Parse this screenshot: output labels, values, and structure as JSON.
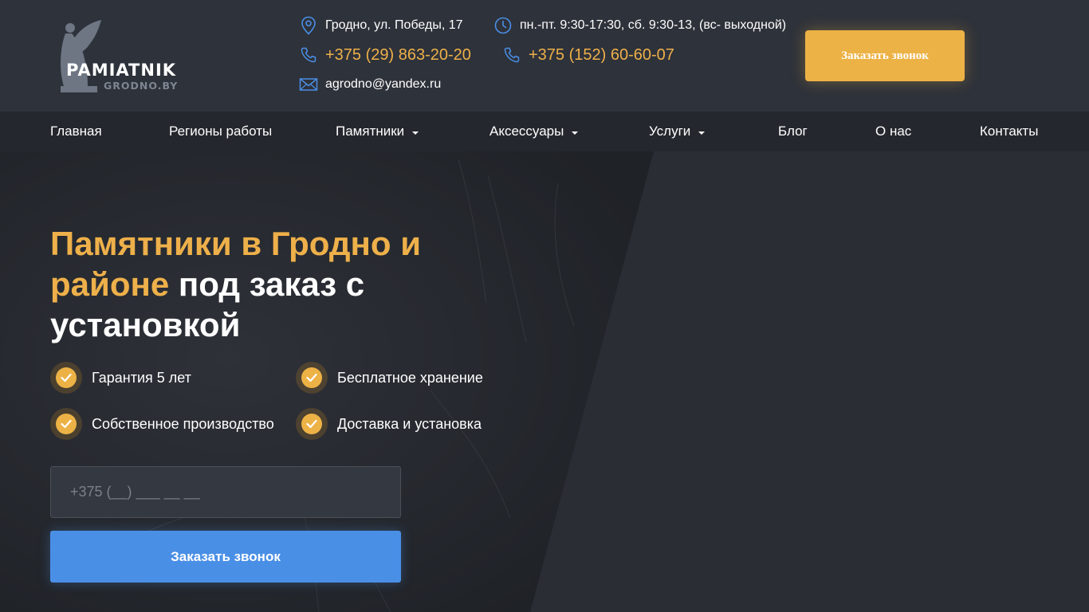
{
  "brand": {
    "name": "PAMIATNIK",
    "domain": "GRODNO.BY"
  },
  "contacts": {
    "address": "Гродно, ул. Победы, 17",
    "hours": "пн.-пт. 9:30-17:30, сб. 9:30-13, (вс- выходной)",
    "phone_mobile": "+375 (29) 863-20-20",
    "phone_city": "+375 (152) 60-60-07",
    "email": "agrodno@yandex.ru"
  },
  "header": {
    "callback_label": "Заказать звонок"
  },
  "nav": {
    "items": [
      {
        "label": "Главная",
        "dropdown": false
      },
      {
        "label": "Регионы работы",
        "dropdown": false
      },
      {
        "label": "Памятники",
        "dropdown": true
      },
      {
        "label": "Аксессуары",
        "dropdown": true
      },
      {
        "label": "Услуги",
        "dropdown": true
      },
      {
        "label": "Блог",
        "dropdown": false
      },
      {
        "label": "О нас",
        "dropdown": false
      },
      {
        "label": "Контакты",
        "dropdown": false
      }
    ]
  },
  "hero": {
    "title_accent": "Памятники в Гродно и районе",
    "title_rest": "под заказ с установкой",
    "features": [
      "Гарантия 5 лет",
      "Бесплатное хранение",
      "Собственное производство",
      "Доставка и установка"
    ],
    "phone_placeholder": "+375 (__) ___ __ __",
    "submit_label": "Заказать звонок"
  },
  "colors": {
    "accent": "#eeb04a",
    "button_blue": "#4a8fe6",
    "icon_blue": "#4a8fe6",
    "header_bg": "#2e323a",
    "nav_bg": "#24272d"
  }
}
